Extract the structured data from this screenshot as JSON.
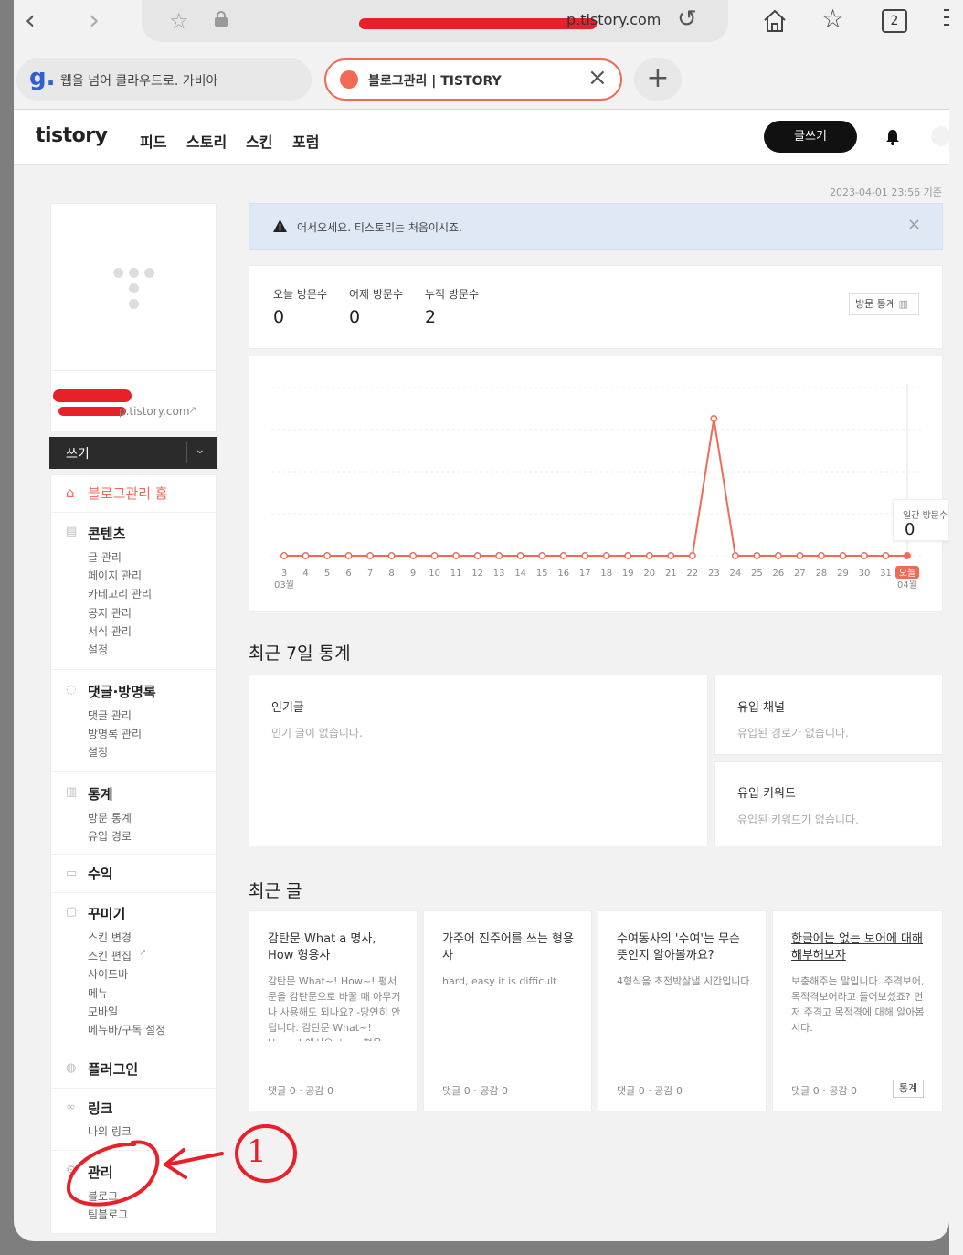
{
  "browser": {
    "url": "p.tistory.com",
    "tab_count": "2",
    "tab1_label": "웹을 넘어 클라우드로. 가비아",
    "tab2_label": "블로그관리 | TISTORY"
  },
  "header": {
    "logo": "tistory",
    "nav": [
      "피드",
      "스토리",
      "스킨",
      "포럼"
    ],
    "write_label": "글쓰기"
  },
  "sidebar": {
    "blog_url": "p.tistory.com",
    "write_select": "쓰기",
    "home_label": "블로그관리 홈",
    "groups": [
      {
        "title": "콘텐츠",
        "items": [
          "글 관리",
          "페이지 관리",
          "카테고리 관리",
          "공지 관리",
          "서식 관리",
          "설정"
        ]
      },
      {
        "title": "댓글·방명록",
        "items": [
          "댓글 관리",
          "방명록 관리",
          "설정"
        ]
      },
      {
        "title": "통계",
        "items": [
          "방문 통계",
          "유입 경로"
        ]
      },
      {
        "title": "수익",
        "items": []
      },
      {
        "title": "꾸미기",
        "items": [
          "스킨 변경",
          "스킨 편집",
          "사이드바",
          "메뉴",
          "모바일",
          "메뉴바/구독 설정"
        ]
      },
      {
        "title": "플러그인",
        "items": []
      },
      {
        "title": "링크",
        "items": [
          "나의 링크"
        ]
      },
      {
        "title": "관리",
        "items": [
          "블로그",
          "팀블로그"
        ]
      }
    ]
  },
  "main": {
    "timestamp": "2023-04-01 23:56 기준",
    "notice": "어서오세요. 티스토리는 처음이시죠.",
    "stats": [
      {
        "label": "오늘 방문수",
        "value": "0"
      },
      {
        "label": "어제 방문수",
        "value": "0"
      },
      {
        "label": "누적 방문수",
        "value": "2"
      }
    ],
    "stats_button": "방문 통계",
    "chart_tooltip_label": "일간 방문수",
    "chart_tooltip_value": "0",
    "recent7_title": "최근 7일 통계",
    "popular_title": "인기글",
    "popular_empty": "인기 글이 없습니다.",
    "channel_title": "유입 채널",
    "channel_empty": "유입된 경로가 없습니다.",
    "keyword_title": "유입 키워드",
    "keyword_empty": "유입된 키워드가 없습니다.",
    "recent_posts_title": "최근 글",
    "posts": [
      {
        "title": "감탄문 What a 명사, How 형용사",
        "body": "감탄문 What~! How~! 평서문을 감탄문으로 바꿀 때 아무거나 사용해도 되나요? -당연히 안됩니다. 감탄문 What~! How~! 에서요. how 형용",
        "meta": "댓글 0 · 공감 0"
      },
      {
        "title": "가주어 진주어를 쓰는 형용사",
        "body": "hard, easy it is difficult",
        "meta": "댓글 0 · 공감 0"
      },
      {
        "title": "수여동사의 '수여'는 무슨 뜻인지 알아볼까요?",
        "body": "4형식을 초전박살낼 시간입니다.",
        "meta": "댓글 0 · 공감 0"
      },
      {
        "title": "한글에는 없는 보어에 대해 해부해보자",
        "body": "보충해주는 말입니다. 주격보어, 목적격보어라고 들어보셨죠? 먼저 주격고 목적격에 대해 알아봅시다.",
        "meta": "댓글 0 · 공감 0",
        "button": "통계"
      }
    ]
  },
  "annotation": {
    "number": "1"
  },
  "chart_data": {
    "type": "line",
    "x": [
      "3",
      "4",
      "5",
      "6",
      "7",
      "8",
      "9",
      "10",
      "11",
      "12",
      "13",
      "14",
      "15",
      "16",
      "17",
      "18",
      "19",
      "20",
      "21",
      "22",
      "23",
      "24",
      "25",
      "26",
      "27",
      "28",
      "29",
      "30",
      "31",
      "오늘"
    ],
    "values": [
      0,
      0,
      0,
      0,
      0,
      0,
      0,
      0,
      0,
      0,
      0,
      0,
      0,
      0,
      0,
      0,
      0,
      0,
      0,
      0,
      1,
      0,
      0,
      0,
      0,
      0,
      0,
      0,
      0,
      0
    ],
    "start_month": "03월",
    "end_month": "04월",
    "ylim": [
      0,
      1
    ],
    "grid": true,
    "color": "#f26a55"
  },
  "colors": {
    "accent": "#f26a55",
    "notice_bg": "#dfe9f5",
    "annotation": "#e8202a"
  }
}
